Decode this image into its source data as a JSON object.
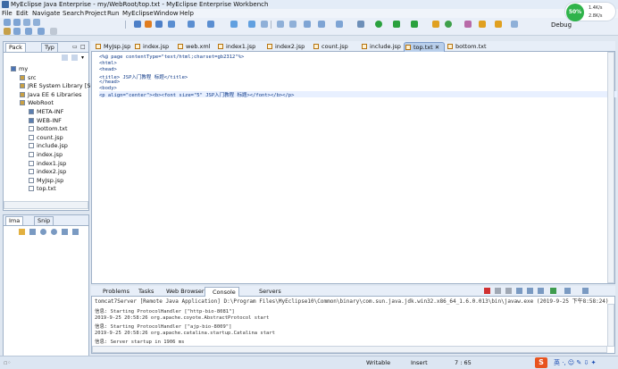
{
  "window": {
    "title": "MyEclipse Java Enterprise - my/WebRoot/top.txt - MyEclipse Enterprise Workbench"
  },
  "menu": [
    "File",
    "Edit",
    "Navigate",
    "Search",
    "Project",
    "Run",
    "MyEclipse",
    "Window",
    "Help"
  ],
  "perspective": "Debug",
  "net": {
    "percent": "50%",
    "up": "1.4K/s",
    "down": "2.8K/s"
  },
  "package_explorer": {
    "tabs": [
      "Pack",
      "Typ"
    ],
    "tree": [
      {
        "label": "my",
        "depth": 0
      },
      {
        "label": "src",
        "depth": 1
      },
      {
        "label": "JRE System Library [Su",
        "depth": 1
      },
      {
        "label": "Java EE 6 Libraries",
        "depth": 1
      },
      {
        "label": "WebRoot",
        "depth": 1
      },
      {
        "label": "META-INF",
        "depth": 2
      },
      {
        "label": "WEB-INF",
        "depth": 2
      },
      {
        "label": "bottom.txt",
        "depth": 2
      },
      {
        "label": "count.jsp",
        "depth": 2
      },
      {
        "label": "include.jsp",
        "depth": 2
      },
      {
        "label": "index.jsp",
        "depth": 2
      },
      {
        "label": "index1.jsp",
        "depth": 2
      },
      {
        "label": "index2.jsp",
        "depth": 2
      },
      {
        "label": "MyJsp.jsp",
        "depth": 2
      },
      {
        "label": "top.txt",
        "depth": 2
      }
    ]
  },
  "image_panel": {
    "tabs": [
      "Ima",
      "Snip"
    ]
  },
  "editor": {
    "tabs": [
      "MyJsp.jsp",
      "index.jsp",
      "web.xml",
      "index1.jsp",
      "index2.jsp",
      "count.jsp",
      "include.jsp",
      "top.txt",
      "bottom.txt"
    ],
    "active_tab": "top.txt",
    "lines": [
      "<%@ page contentType=\"text/html;charset=gb2312\"%>",
      "<html>",
      "<head>",
      "<title> JSP入门教程 标题</title>",
      "</head>",
      "<body>",
      "<p align=\"center\"><b><font size=\"5\" JSP入门教程 标题></font></b></p>"
    ]
  },
  "console": {
    "tabs": [
      "Problems",
      "Tasks",
      "Web Browser",
      "Console",
      "Servers"
    ],
    "active": "Console",
    "header": "tomcat7Server [Remote Java Application] D:\\Program Files\\MyEclipse10\\Common\\binary\\com.sun.java.jdk.win32.x86_64_1.6.0.013\\bin\\javaw.exe (2019-9-25 下午8:58:24)",
    "lines": [
      "信息: Starting ProtocolHandler [\"http-bio-8081\"]",
      "2019-9-25 20:58:26 org.apache.coyote.AbstractProtocol start",
      "信息: Starting ProtocolHandler [\"ajp-bio-8009\"]",
      "2019-9-25 20:58:26 org.apache.catalina.startup.Catalina start",
      "信息: Server startup in 1906 ms"
    ]
  },
  "status": {
    "mode": "Writable",
    "insert": "Insert",
    "position": "7 : 65"
  }
}
